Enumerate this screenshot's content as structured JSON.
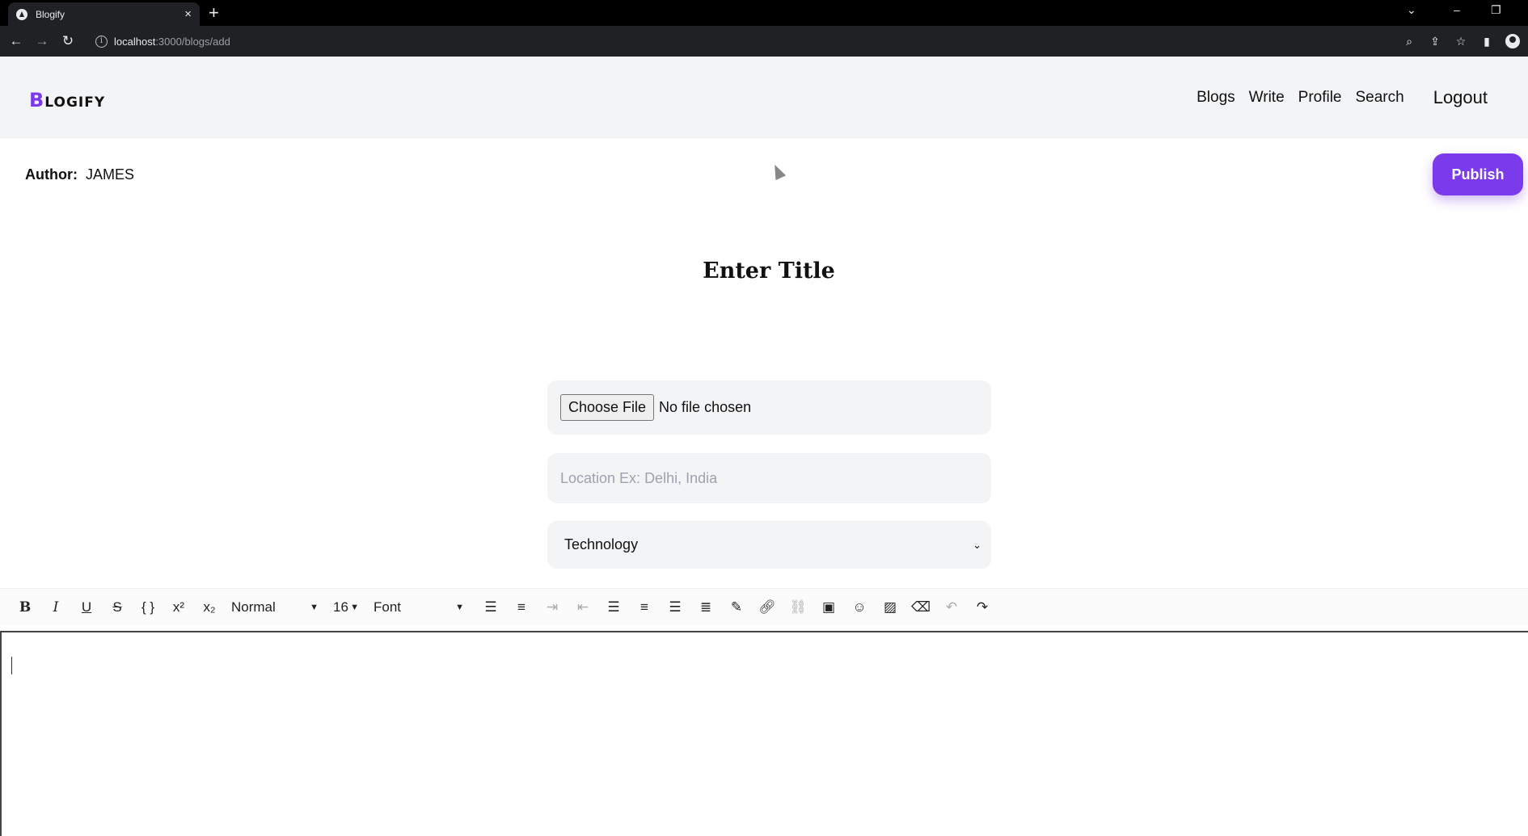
{
  "browser": {
    "tab_title": "Blogify",
    "tab_close": "×",
    "new_tab": "+",
    "url_host": "localhost",
    "url_path": ":3000/blogs/add",
    "window_controls": [
      "⌄",
      "–",
      "❐"
    ]
  },
  "header": {
    "logo_first": "B",
    "logo_rest": "LOGIFY",
    "nav": [
      "Blogs",
      "Write",
      "Profile",
      "Search"
    ],
    "logout": "Logout"
  },
  "author": {
    "label": "Author:",
    "name": "JAMES"
  },
  "publish_label": "Publish",
  "title_placeholder": "Enter Title",
  "form": {
    "choose_file": "Choose File",
    "no_file": "No file chosen",
    "location_placeholder": "Location Ex: Delhi, India",
    "category": "Technology"
  },
  "editor_toolbar": {
    "bold": "B",
    "italic": "I",
    "underline": "U",
    "strike": "S",
    "code": "{ }",
    "superscript": "x²",
    "subscript": "x₂",
    "block_type": "Normal",
    "font_size": "16",
    "font_family": "Font"
  }
}
